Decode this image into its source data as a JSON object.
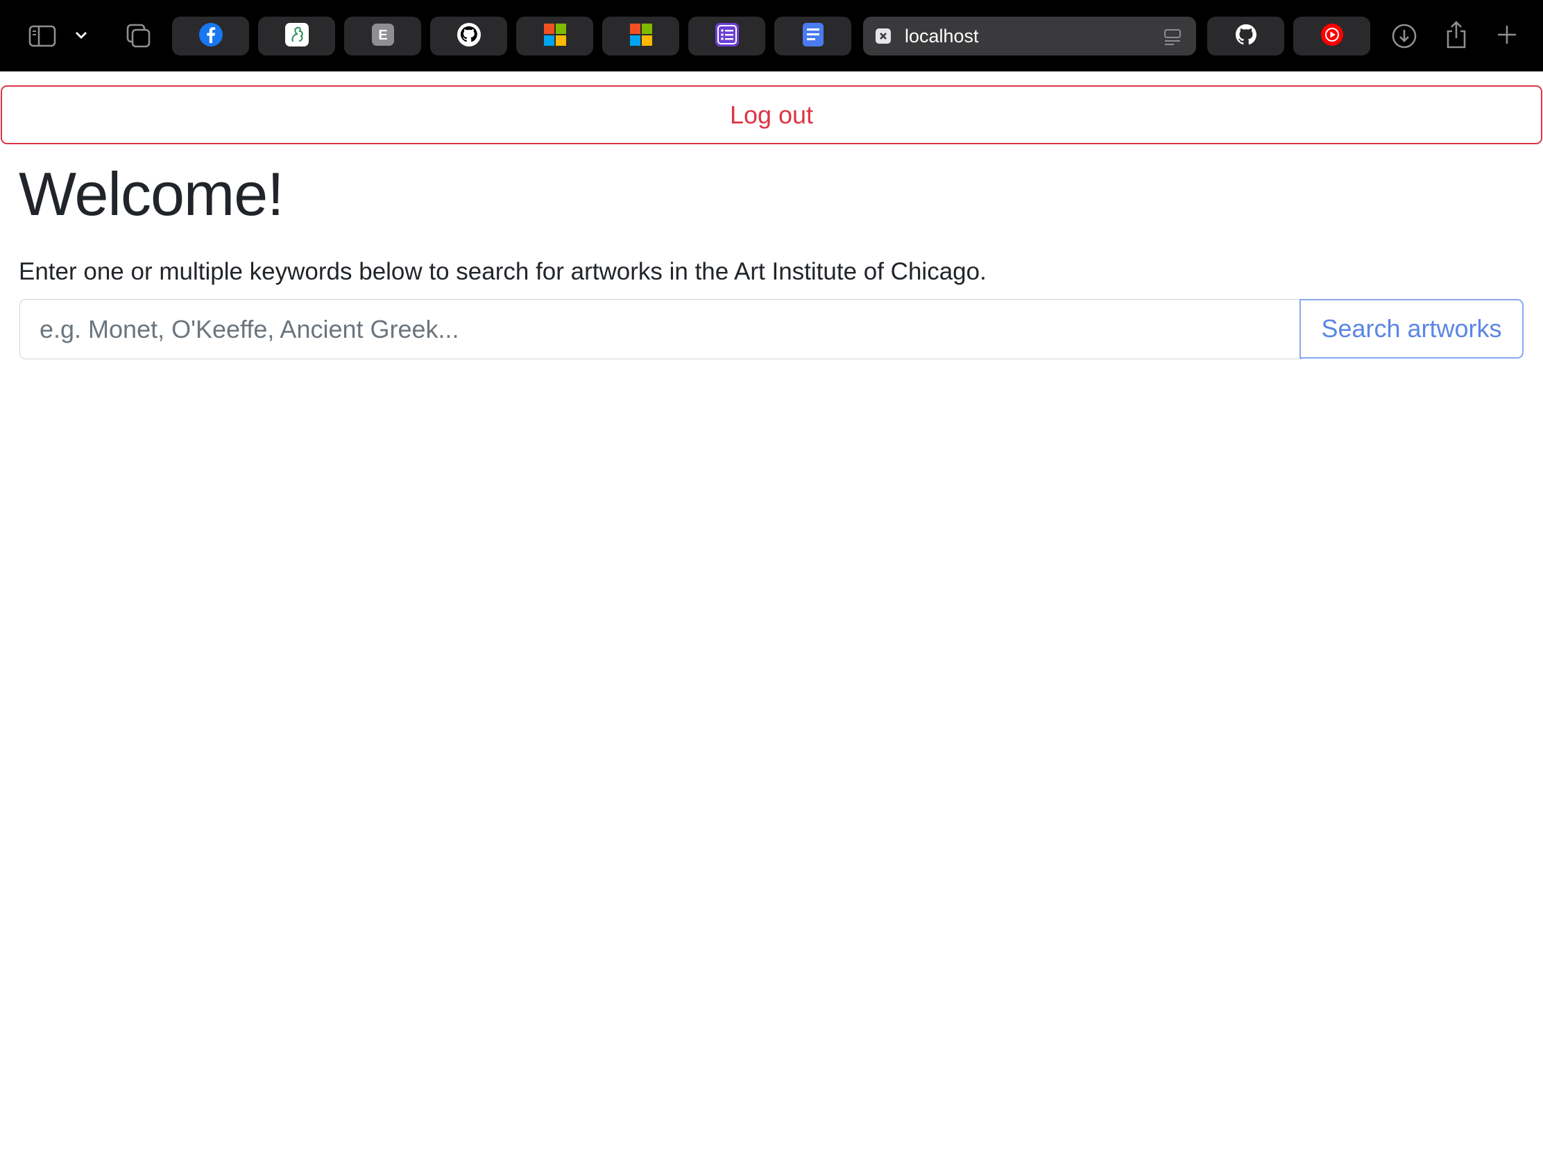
{
  "browser": {
    "tabs": [
      {
        "icon": "facebook-icon"
      },
      {
        "icon": "dragon-icon"
      },
      {
        "icon": "letter-e-icon"
      },
      {
        "icon": "github-icon"
      },
      {
        "icon": "microsoft-icon"
      },
      {
        "icon": "microsoft-icon"
      },
      {
        "icon": "list-app-icon"
      },
      {
        "icon": "docs-icon"
      }
    ],
    "active_tab": {
      "url": "localhost"
    },
    "extra_tabs": [
      {
        "icon": "github-icon"
      },
      {
        "icon": "youtube-music-icon"
      }
    ],
    "colors": {
      "toolbar_bg": "#000000",
      "tab_bg": "#2a2a2c",
      "active_tab_bg": "#3a3a3c"
    }
  },
  "page": {
    "logout_label": "Log out",
    "title": "Welcome!",
    "intro": "Enter one or multiple keywords below to search for artworks in the Art Institute of Chicago.",
    "search": {
      "placeholder": "e.g. Monet, O'Keeffe, Ancient Greek...",
      "value": "",
      "button_label": "Search artworks"
    },
    "colors": {
      "danger": "#dc3545",
      "primary": "#5b86e5",
      "text": "#212529"
    }
  }
}
